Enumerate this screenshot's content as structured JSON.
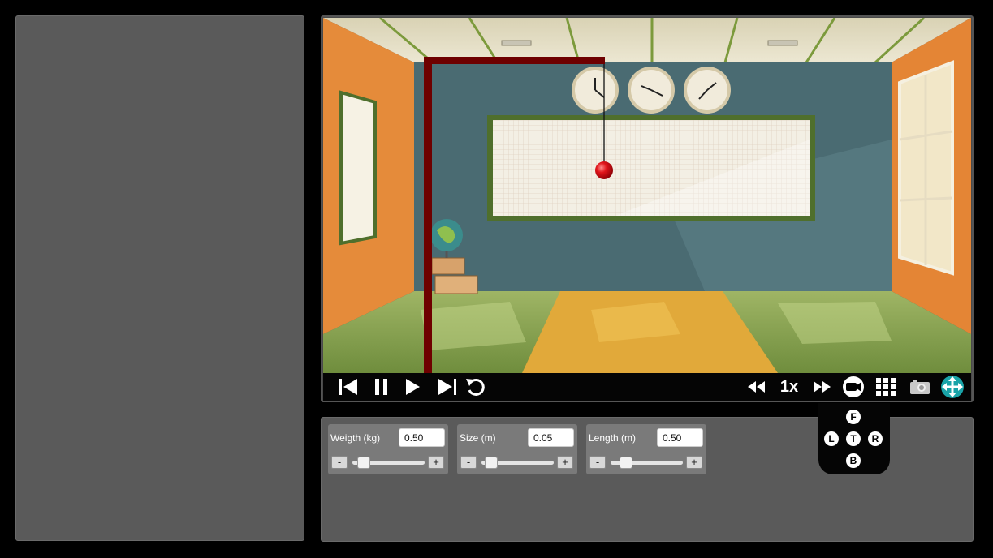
{
  "toolbar": {
    "speed_label": "1x",
    "items": [
      "skip-back",
      "pause",
      "play",
      "step-forward",
      "reset",
      "rewind",
      "speed",
      "fast-forward",
      "camera",
      "grid",
      "screenshot",
      "move"
    ]
  },
  "controls": [
    {
      "label": "Weigth (kg)",
      "value": "0.50",
      "minus": "-",
      "plus": "+",
      "level": 0.1
    },
    {
      "label": "Size (m)",
      "value": "0.05",
      "minus": "-",
      "plus": "+",
      "level": 0.1
    },
    {
      "label": "Length (m)",
      "value": "0.50",
      "minus": "-",
      "plus": "+",
      "level": 0.1
    }
  ],
  "camera_views": {
    "front": "F",
    "left": "L",
    "top": "T",
    "right": "R",
    "back": "B"
  },
  "colors": {
    "frame_red": "#6e0000",
    "ball_red": "#e0141a",
    "move_accent": "#1aa3a8",
    "panel_gray": "#5a5a5a"
  }
}
